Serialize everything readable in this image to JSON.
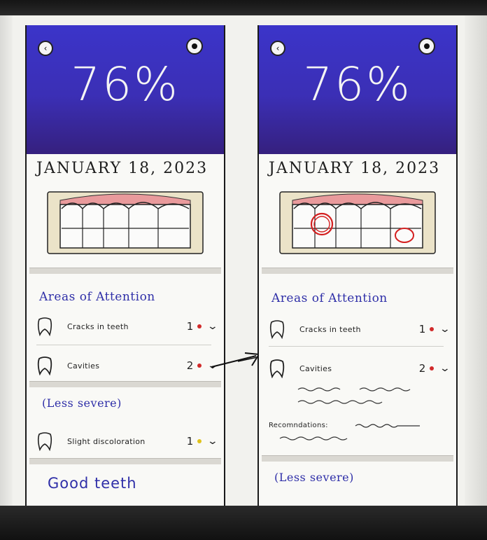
{
  "screens": [
    {
      "score": "76%",
      "date": "JANUARY 18, 2023",
      "areas_title": "Areas of Attention",
      "items": [
        {
          "label": "Cracks in teeth",
          "count": "1",
          "severity_color": "#d12a2a"
        },
        {
          "label": "Cavities",
          "count": "2",
          "severity_color": "#d12a2a"
        }
      ],
      "less_severe_title": "(Less severe)",
      "less_items": [
        {
          "label": "Slight discoloration",
          "count": "1",
          "severity_color": "#e0c21a"
        }
      ],
      "good_title": "Good teeth"
    },
    {
      "score": "76%",
      "date": "JANUARY 18, 2023",
      "areas_title": "Areas of Attention",
      "items": [
        {
          "label": "Cracks in teeth",
          "count": "1",
          "severity_color": "#d12a2a"
        },
        {
          "label": "Cavities",
          "count": "2",
          "severity_color": "#d12a2a"
        }
      ],
      "recommendations_label": "Recomndations:",
      "less_severe_title": "(Less severe)"
    }
  ],
  "icons": {
    "back": "back-arrow-icon",
    "camera": "camera-icon",
    "tooth": "tooth-icon",
    "chevron": "chevron-down-icon"
  },
  "colors": {
    "header_top": "#3b34c9",
    "header_bottom": "#35207e",
    "section_title": "#2f2fa8",
    "cavity_marker": "#d42020"
  }
}
